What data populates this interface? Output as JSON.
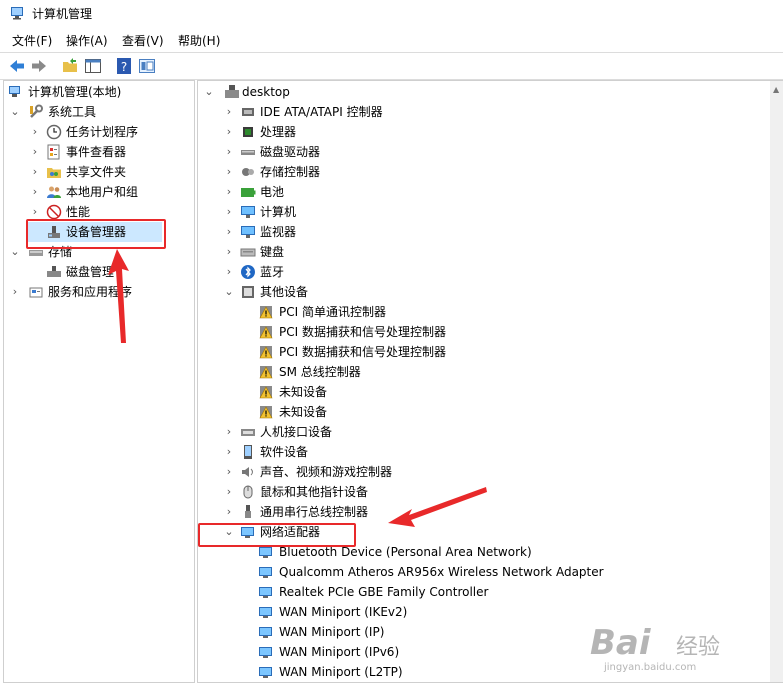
{
  "window": {
    "title": "计算机管理"
  },
  "menu": [
    "文件(F)",
    "操作(A)",
    "查看(V)",
    "帮助(H)"
  ],
  "left_tree": {
    "root": "计算机管理(本地)",
    "system_tools": "系统工具",
    "items": [
      "任务计划程序",
      "事件查看器",
      "共享文件夹",
      "本地用户和组",
      "性能",
      "设备管理器"
    ],
    "storage": "存储",
    "disk_mgmt": "磁盘管理",
    "services": "服务和应用程序"
  },
  "right_tree": {
    "root": "desktop",
    "categories_top": [
      "IDE ATA/ATAPI 控制器",
      "处理器",
      "磁盘驱动器",
      "存储控制器",
      "电池",
      "计算机",
      "监视器",
      "键盘",
      "蓝牙"
    ],
    "other_devices": "其他设备",
    "other_children": [
      "PCI 简单通讯控制器",
      "PCI 数据捕获和信号处理控制器",
      "PCI 数据捕获和信号处理控制器",
      "SM 总线控制器",
      "未知设备",
      "未知设备"
    ],
    "categories_mid": [
      "人机接口设备",
      "软件设备",
      "声音、视频和游戏控制器",
      "鼠标和其他指针设备",
      "通用串行总线控制器"
    ],
    "network": "网络适配器",
    "network_children": [
      "Bluetooth Device (Personal Area Network)",
      "Qualcomm Atheros AR956x Wireless Network Adapter",
      "Realtek PCIe GBE Family Controller",
      "WAN Miniport (IKEv2)",
      "WAN Miniport (IP)",
      "WAN Miniport (IPv6)",
      "WAN Miniport (L2TP)"
    ]
  },
  "watermark": {
    "main": "Bai",
    "sub": "经验",
    "url": "jingyan.baidu.com"
  },
  "colors": {
    "annotation_red": "#e8292a",
    "selection": "#cce8ff"
  }
}
